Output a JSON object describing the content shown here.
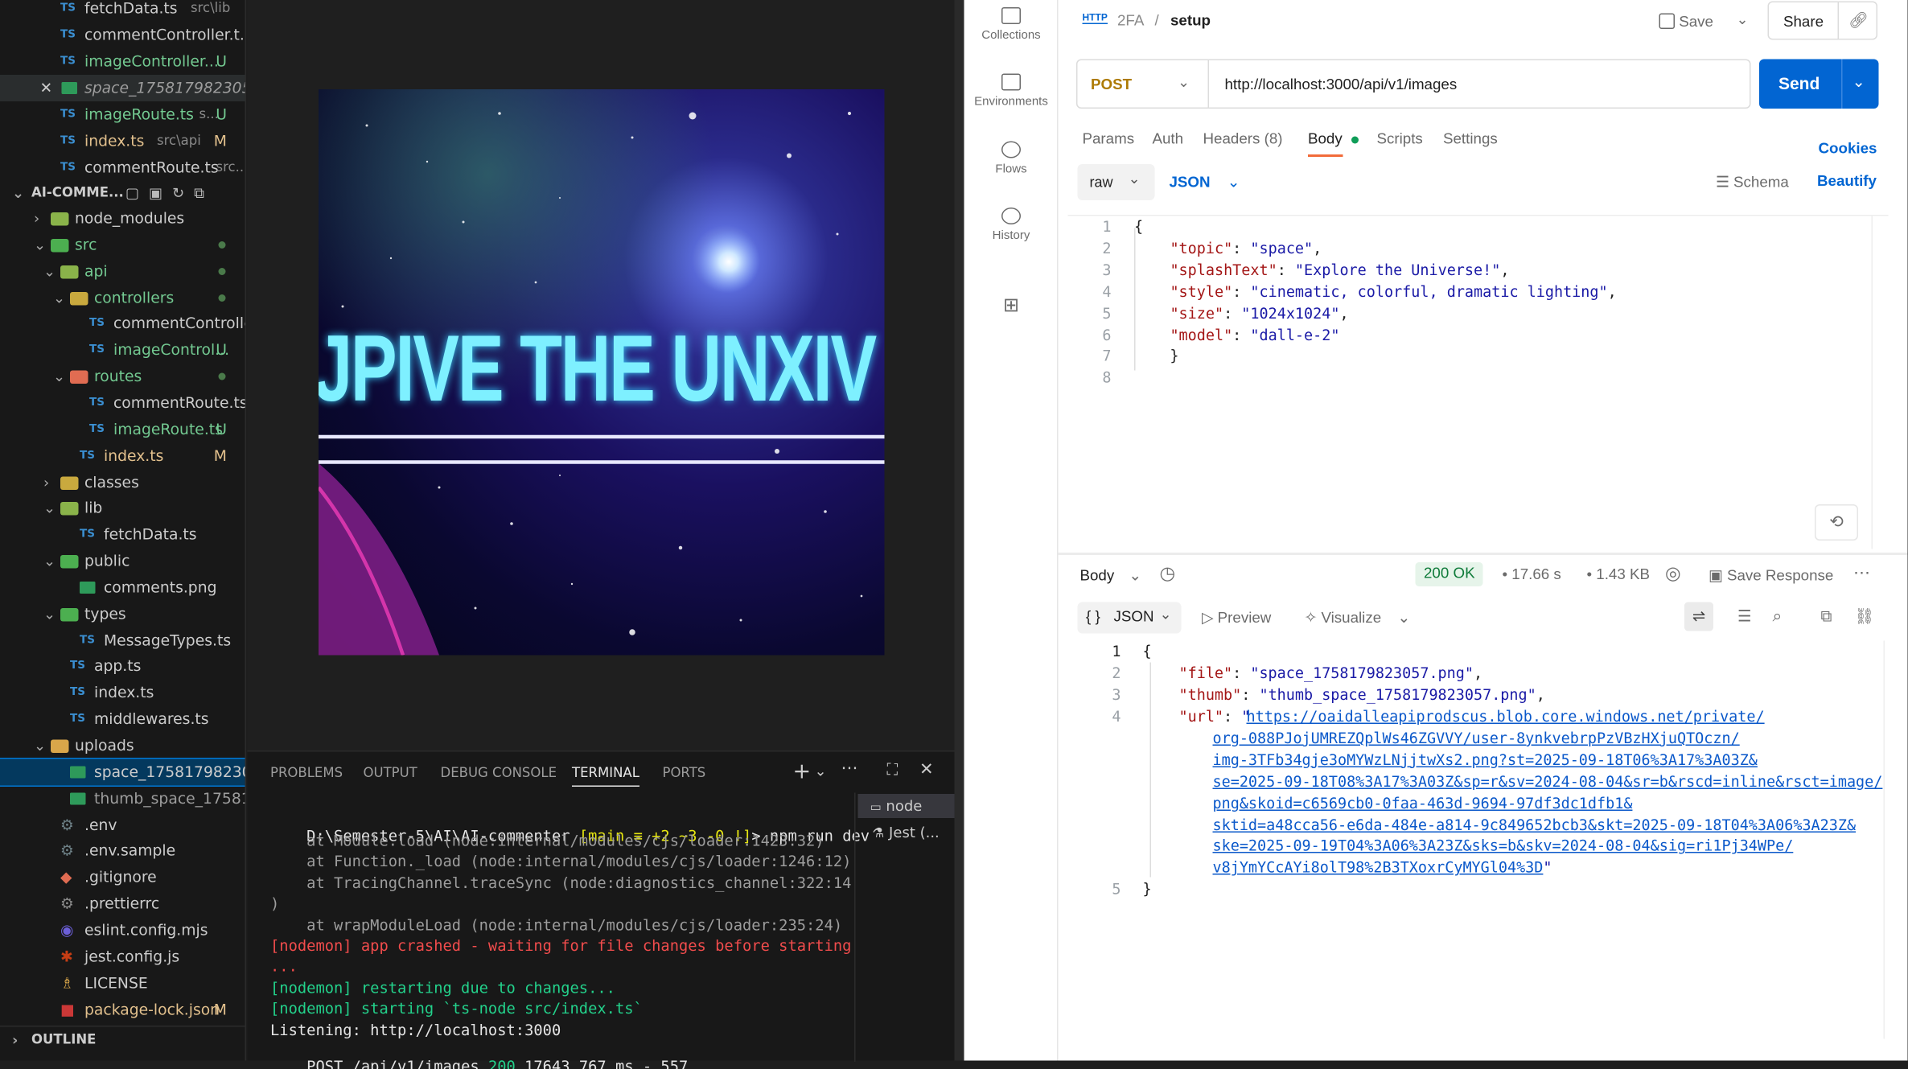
{
  "explorer": {
    "top_files": [
      {
        "name": "fetchData.ts",
        "hint": "src\\lib",
        "status": ""
      },
      {
        "name": "commentController.t...",
        "hint": "",
        "status": ""
      },
      {
        "name": "imageController...",
        "hint": "",
        "status": "U"
      },
      {
        "name": "space_175817982305...",
        "hint": "",
        "status": ""
      },
      {
        "name": "imageRoute.ts",
        "hint": "s...",
        "status": "U"
      },
      {
        "name": "index.ts",
        "hint": "src\\api",
        "status": "M"
      },
      {
        "name": "commentRoute.ts",
        "hint": "src...",
        "status": ""
      }
    ],
    "project_header": "AI-COMME...",
    "tree": [
      {
        "name": "node_modules",
        "level": 1,
        "kind": "folder",
        "open": false
      },
      {
        "name": "src",
        "level": 1,
        "kind": "folder",
        "open": true
      },
      {
        "name": "api",
        "level": 2,
        "kind": "folder",
        "open": true
      },
      {
        "name": "controllers",
        "level": 3,
        "kind": "folder",
        "open": true
      },
      {
        "name": "commentControlle...",
        "level": 4,
        "kind": "ts",
        "status": ""
      },
      {
        "name": "imageControl...",
        "level": 4,
        "kind": "ts",
        "status": "U"
      },
      {
        "name": "routes",
        "level": 3,
        "kind": "folder",
        "open": true
      },
      {
        "name": "commentRoute.ts",
        "level": 4,
        "kind": "ts",
        "status": ""
      },
      {
        "name": "imageRoute.ts",
        "level": 4,
        "kind": "ts",
        "status": "U"
      },
      {
        "name": "index.ts",
        "level": 3,
        "kind": "ts",
        "status": "M"
      },
      {
        "name": "classes",
        "level": 2,
        "kind": "folder",
        "open": false
      },
      {
        "name": "lib",
        "level": 2,
        "kind": "folder",
        "open": true
      },
      {
        "name": "fetchData.ts",
        "level": 3,
        "kind": "ts",
        "status": ""
      },
      {
        "name": "public",
        "level": 2,
        "kind": "folder",
        "open": true
      },
      {
        "name": "comments.png",
        "level": 3,
        "kind": "img",
        "status": ""
      },
      {
        "name": "types",
        "level": 2,
        "kind": "folder",
        "open": true
      },
      {
        "name": "MessageTypes.ts",
        "level": 3,
        "kind": "ts",
        "status": ""
      },
      {
        "name": "app.ts",
        "level": 2,
        "kind": "ts",
        "status": ""
      },
      {
        "name": "index.ts",
        "level": 2,
        "kind": "ts",
        "status": ""
      },
      {
        "name": "middlewares.ts",
        "level": 2,
        "kind": "ts",
        "status": ""
      },
      {
        "name": "uploads",
        "level": 1,
        "kind": "folder",
        "open": true
      },
      {
        "name": "space_175817982305...",
        "level": 2,
        "kind": "img",
        "status": ""
      },
      {
        "name": "thumb_space_175817...",
        "level": 2,
        "kind": "img",
        "status": ""
      },
      {
        "name": ".env",
        "level": 1,
        "kind": "gear",
        "status": ""
      },
      {
        "name": ".env.sample",
        "level": 1,
        "kind": "gear",
        "status": ""
      },
      {
        "name": ".gitignore",
        "level": 1,
        "kind": "git",
        "status": ""
      },
      {
        "name": ".prettierrc",
        "level": 1,
        "kind": "other",
        "status": ""
      },
      {
        "name": "eslint.config.mjs",
        "level": 1,
        "kind": "eslint",
        "status": ""
      },
      {
        "name": "jest.config.js",
        "level": 1,
        "kind": "jest",
        "status": ""
      },
      {
        "name": "LICENSE",
        "level": 1,
        "kind": "license",
        "status": ""
      },
      {
        "name": "package-lock.json",
        "level": 1,
        "kind": "npm",
        "status": "M"
      }
    ],
    "outline": "OUTLINE"
  },
  "image_text": "JPIVE THE UNXIV",
  "terminal": {
    "tabs": [
      "PROBLEMS",
      "OUTPUT",
      "DEBUG CONSOLE",
      "TERMINAL",
      "PORTS"
    ],
    "active_tab": "TERMINAL",
    "prompt_path": "D:\\Semester-5\\AI\\AI-commenter",
    "prompt_branch": "[main ≡ +2 ~3 -0 !]",
    "prompt_cmd": "> npm run dev",
    "lines": [
      {
        "t": "    at Module.load (node:internal/modules/cjs/loader:1423:32)",
        "c": "#9d9d9d"
      },
      {
        "t": "    at Function._load (node:internal/modules/cjs/loader:1246:12)",
        "c": "#9d9d9d"
      },
      {
        "t": "    at TracingChannel.traceSync (node:diagnostics_channel:322:14",
        "c": "#9d9d9d"
      },
      {
        "t": ")",
        "c": "#9d9d9d"
      },
      {
        "t": "    at wrapModuleLoad (node:internal/modules/cjs/loader:235:24)",
        "c": "#9d9d9d"
      },
      {
        "t": "[nodemon] app crashed - waiting for file changes before starting",
        "c": "#f14c4c"
      },
      {
        "t": "...",
        "c": "#f14c4c"
      },
      {
        "t": "[nodemon] restarting due to changes...",
        "c": "#23d18b"
      },
      {
        "t": "[nodemon] starting `ts-node src/index.ts`",
        "c": "#23d18b"
      },
      {
        "t": "Listening: http://localhost:3000",
        "c": "#e5e5e5"
      }
    ],
    "last_line_pre": "POST /api/v1/images ",
    "last_line_status": "200",
    "last_line_post": " 17643.767 ms - 557",
    "sessions": [
      "node",
      "Jest (..."
    ]
  },
  "postman": {
    "sidebar": [
      "Collections",
      "Environments",
      "Flows",
      "History"
    ],
    "breadcrumb_parent": "2FA",
    "breadcrumb_sep": "/",
    "request_name": "setup",
    "save": "Save",
    "share": "Share",
    "method": "POST",
    "url": "http://localhost:3000/api/v1/images",
    "send": "Send",
    "tabs": [
      "Params",
      "Auth",
      "Headers (8)",
      "Body",
      "Scripts",
      "Settings"
    ],
    "cookies": "Cookies",
    "body_mode": "raw",
    "body_format": "JSON",
    "schema": "Schema",
    "beautify": "Beautify",
    "request_body": [
      "{",
      "    \"topic\": \"space\",",
      "    \"splashText\": \"Explore the Universe!\",",
      "    \"style\": \"cinematic, colorful, dramatic lighting\",",
      "    \"size\": \"1024x1024\",",
      "    \"model\": \"dall-e-2\"",
      "    }",
      ""
    ],
    "response": {
      "section": "Body",
      "status": "200 OK",
      "time": "17.66 s",
      "size": "1.43 KB",
      "save_response": "Save Response",
      "format": "JSON",
      "preview": "Preview",
      "visualize": "Visualize",
      "line1": "{",
      "file_key": "\"file\"",
      "file_val": "\"space_1758179823057.png\"",
      "thumb_key": "\"thumb\"",
      "thumb_val": "\"thumb_space_1758179823057.png\"",
      "url_key": "\"url\"",
      "url_lines": [
        "https://oaidalleapiprodscus.blob.core.windows.net/private/",
        "org-088PJojUMREZQplWs46ZGVVY/user-8ynkvebrpPzVBzHXjuQTOczn/",
        "img-3TFb34gje3oMYWzLNjjtwXs2.png?st=2025-09-18T06%3A17%3A03Z&",
        "se=2025-09-18T08%3A17%3A03Z&sp=r&sv=2024-08-04&sr=b&rscd=inline&rsct=image/",
        "png&skoid=c6569cb0-0faa-463d-9694-97df3dc1dfb1&",
        "sktid=a48cca56-e6da-484e-a814-9c849652bcb3&skt=2025-09-18T04%3A06%3A23Z&",
        "ske=2025-09-19T04%3A06%3A23Z&sks=b&skv=2024-08-04&sig=ri1Pj34WPe/",
        "v8jYmYCcAYi8olT98%2B3TXoxrCyMYGl04%3D"
      ],
      "line5": "}"
    }
  },
  "colors": {
    "accent": "#0265d2",
    "status_ok": "#0f7b3a",
    "ts": "#3b8fd1",
    "untracked": "#73c991",
    "modified": "#e2c08d"
  }
}
